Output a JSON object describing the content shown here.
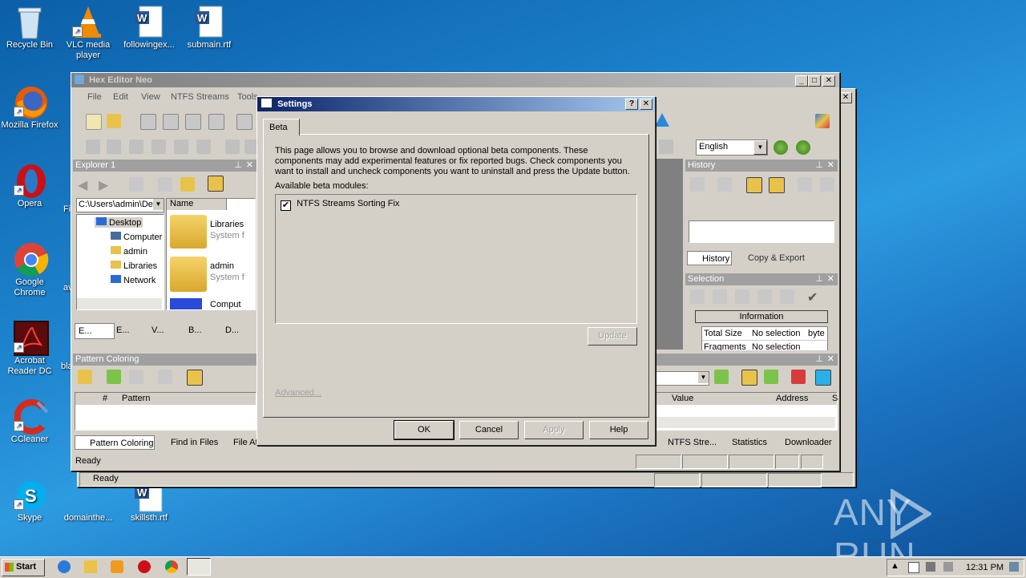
{
  "desktop": {
    "icons": [
      {
        "label": "Recycle Bin"
      },
      {
        "label": "VLC media player"
      },
      {
        "label": "followingex..."
      },
      {
        "label": "submain.rtf"
      },
      {
        "label": "Mozilla Firefox"
      },
      {
        "label": "Opera"
      },
      {
        "label": "Google Chrome"
      },
      {
        "label": "Acrobat Reader DC"
      },
      {
        "label": "CCleaner"
      },
      {
        "label": "Skype"
      },
      {
        "label": "domainthe..."
      },
      {
        "label": "skillsth.rtf"
      }
    ],
    "partial": {
      "fi": "Fi",
      "av": "av",
      "bla": "bla"
    }
  },
  "hexeditor": {
    "title": "Hex Editor Neo",
    "menu": [
      "File",
      "Edit",
      "View",
      "NTFS Streams",
      "Tools"
    ],
    "language": "English",
    "explorer": {
      "title": "Explorer 1",
      "path": "C:\\Users\\admin\\De",
      "tree": [
        "Desktop",
        "Computer",
        "admin",
        "Libraries",
        "Network"
      ],
      "col_name": "Name",
      "items": [
        {
          "name": "Libraries",
          "sub": "System f"
        },
        {
          "name": "admin",
          "sub": "System f"
        },
        {
          "name": "Comput",
          "sub": ""
        }
      ],
      "tabs": [
        "E...",
        "E...",
        "V...",
        "B...",
        "D..."
      ]
    },
    "pattern": {
      "title": "Pattern Coloring",
      "cols": [
        "#",
        "Pattern"
      ]
    },
    "bottom_tabs": [
      "Pattern Coloring",
      "Find in Files",
      "File At",
      "NTFS Stre...",
      "Statistics",
      "Downloader"
    ],
    "history": {
      "title": "History",
      "tabs": [
        "History",
        "Copy & Export"
      ]
    },
    "selection": {
      "title": "Selection",
      "info_header": "Information",
      "rows": [
        {
          "label": "Total Size",
          "value": "No selection",
          "unit": "byte"
        },
        {
          "label": "Fragments",
          "value": "No selection",
          "unit": ""
        }
      ]
    },
    "lower_cols": [
      "Value",
      "Address",
      "S"
    ],
    "status": "Ready"
  },
  "outer_status": "Ready",
  "settings": {
    "title": "Settings",
    "tab": "Beta",
    "description": "This page allows you to browse and download optional beta components. These components may add experimental features or fix reported bugs. Check components you want to install and uncheck components you want to uninstall and press the Update button.",
    "modules_label": "Available beta modules:",
    "modules": [
      {
        "name": "NTFS Streams Sorting Fix",
        "checked": true
      }
    ],
    "update": "Update",
    "advanced": "Advanced...",
    "buttons": {
      "ok": "OK",
      "cancel": "Cancel",
      "apply": "Apply",
      "help": "Help"
    }
  },
  "taskbar": {
    "start": "Start",
    "time": "12:31 PM"
  },
  "watermark": "ANY RUN"
}
